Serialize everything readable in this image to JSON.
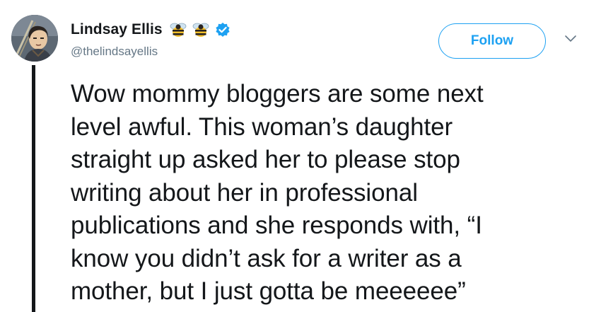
{
  "author": {
    "display_name": "Lindsay Ellis",
    "handle": "@thelindsayellis",
    "name_emojis": [
      "bee-emoji",
      "bee-emoji"
    ],
    "verified": true,
    "avatar": "profile-avatar-illustrated"
  },
  "actions": {
    "follow_label": "Follow",
    "menu_icon": "chevron-down-icon"
  },
  "tweet": {
    "text": "Wow mommy bloggers are some next\nlevel awful. This woman’s daughter\nstraight up asked her to please stop\nwriting about her in professional\npublications and she responds with, “I\nknow you didn’t ask for a writer as a\nmother, but I just gotta be meeeeee”"
  },
  "colors": {
    "accent": "#1da1f2",
    "text": "#14171a",
    "secondary_text": "#657786",
    "background": "#ffffff"
  }
}
